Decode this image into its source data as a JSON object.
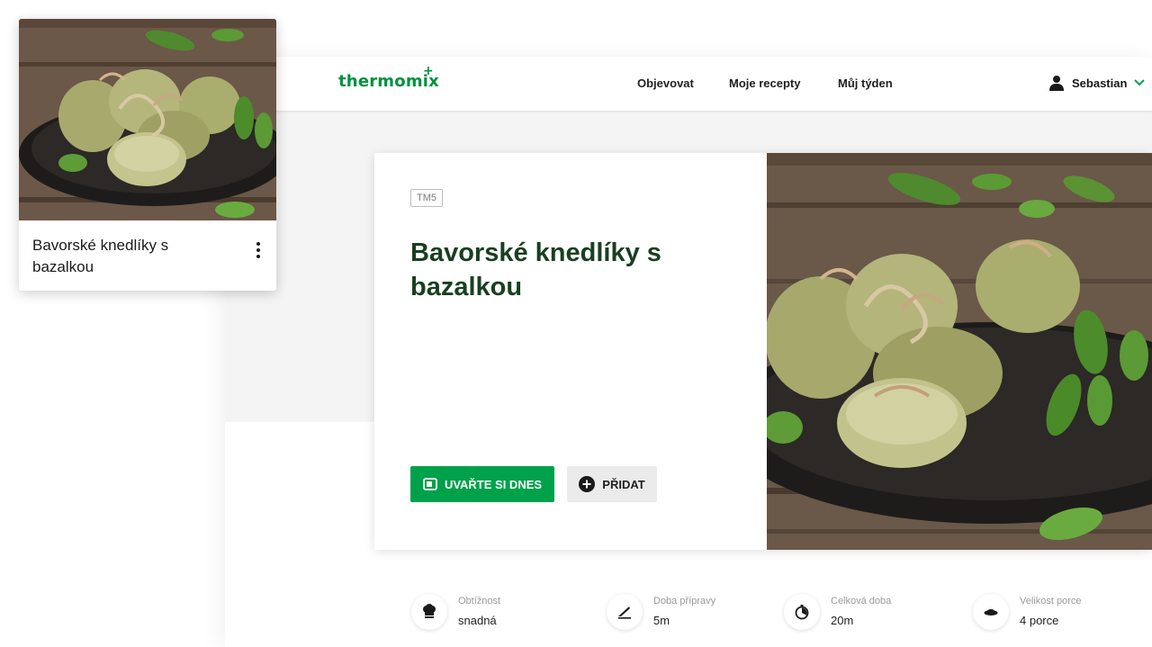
{
  "app": {
    "logo": "thermomix",
    "logo_plus": "+",
    "nav": [
      "Objevovat",
      "Moje recepty",
      "Můj týden"
    ],
    "user": {
      "name": "Sebastian",
      "icon": "user-icon",
      "chevron": "chevron-down-icon"
    },
    "brand_color": "#00a14b",
    "title_color": "#193f20"
  },
  "recipe": {
    "badge": "TM5",
    "title": "Bavorské knedlíky s bazalkou",
    "cook_label": "UVAŘTE SI DNES",
    "add_label": "PŘIDAT",
    "image": "dumplings-plate-photo"
  },
  "stats": [
    {
      "label": "Obtížnost",
      "value": "snadná",
      "icon": "chef-hat-icon"
    },
    {
      "label": "Doba přípravy",
      "value": "5m",
      "icon": "knife-icon"
    },
    {
      "label": "Celková doba",
      "value": "20m",
      "icon": "timer-icon"
    },
    {
      "label": "Velikost porce",
      "value": "4 porce",
      "icon": "plate-icon"
    }
  ],
  "tile": {
    "title": "Bavorské knedlíky s bazalkou",
    "menu_icon": "more-vertical-icon"
  }
}
